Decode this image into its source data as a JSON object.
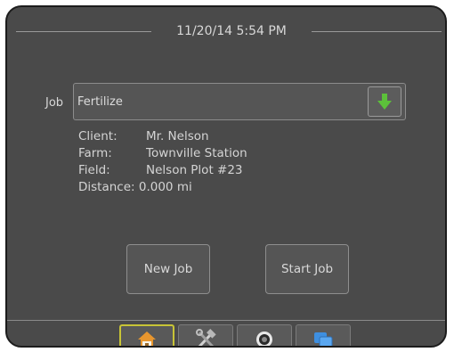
{
  "header": {
    "timestamp": "11/20/14 5:54 PM"
  },
  "job": {
    "label": "Job",
    "value": "Fertilize",
    "dropdown_icon": "green-down-arrow-icon"
  },
  "details": [
    {
      "label": "Client:",
      "value": "Mr. Nelson"
    },
    {
      "label": "Farm:",
      "value": "Townville Station"
    },
    {
      "label": "Field:",
      "value": "Nelson Plot #23"
    },
    {
      "label": "Distance:",
      "value": "0.000 mi"
    }
  ],
  "buttons": {
    "new_job": "New Job",
    "start_job": "Start Job"
  },
  "tabs": [
    {
      "icon": "home-icon",
      "active": true
    },
    {
      "icon": "tools-icon",
      "active": false
    },
    {
      "icon": "guidance-icon",
      "active": false
    },
    {
      "icon": "data-icon",
      "active": false
    }
  ],
  "colors": {
    "background": "#4a4a4a",
    "accent_active_tab": "#c8c436",
    "arrow_green": "#5cc13a",
    "home_orange": "#e8962e",
    "data_blue": "#3e8fe0"
  }
}
